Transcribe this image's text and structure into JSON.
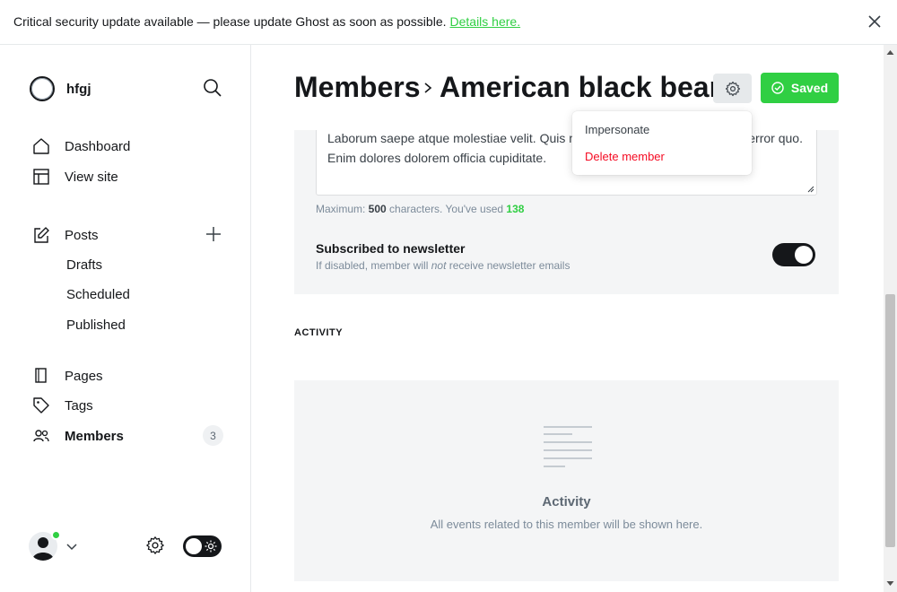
{
  "banner": {
    "message": "Critical security update available — please update Ghost as soon as possible.",
    "link": "Details here."
  },
  "sidebar": {
    "site_name": "hfgj",
    "nav": [
      {
        "label": "Dashboard",
        "icon": "home-icon"
      },
      {
        "label": "View site",
        "icon": "layout-icon"
      }
    ],
    "posts": {
      "label": "Posts",
      "sub": [
        "Drafts",
        "Scheduled",
        "Published"
      ]
    },
    "pages_label": "Pages",
    "tags_label": "Tags",
    "members_label": "Members",
    "members_count": "3"
  },
  "header": {
    "breadcrumb": "Members",
    "title": "American black bear",
    "saved_label": "Saved"
  },
  "dropdown": {
    "impersonate": "Impersonate",
    "delete": "Delete member"
  },
  "form": {
    "note_text": "Laborum saepe atque molestiae velit. Quis mollitia qui reprehenderit eaque error quo. Enim dolores dolorem officia cupiditate.",
    "hint_prefix": "Maximum: ",
    "hint_max": "500",
    "hint_mid": " characters. You've used ",
    "hint_used": "138",
    "newsletter_title": "Subscribed to newsletter",
    "newsletter_desc_pre": "If disabled, member will ",
    "newsletter_desc_em": "not",
    "newsletter_desc_post": " receive newsletter emails",
    "newsletter_on": true
  },
  "activity": {
    "section_label": "ACTIVITY",
    "empty_title": "Activity",
    "empty_desc": "All events related to this member will be shown here."
  },
  "colors": {
    "accent": "#30cf43",
    "danger": "#f50b23",
    "dark": "#15171a"
  }
}
